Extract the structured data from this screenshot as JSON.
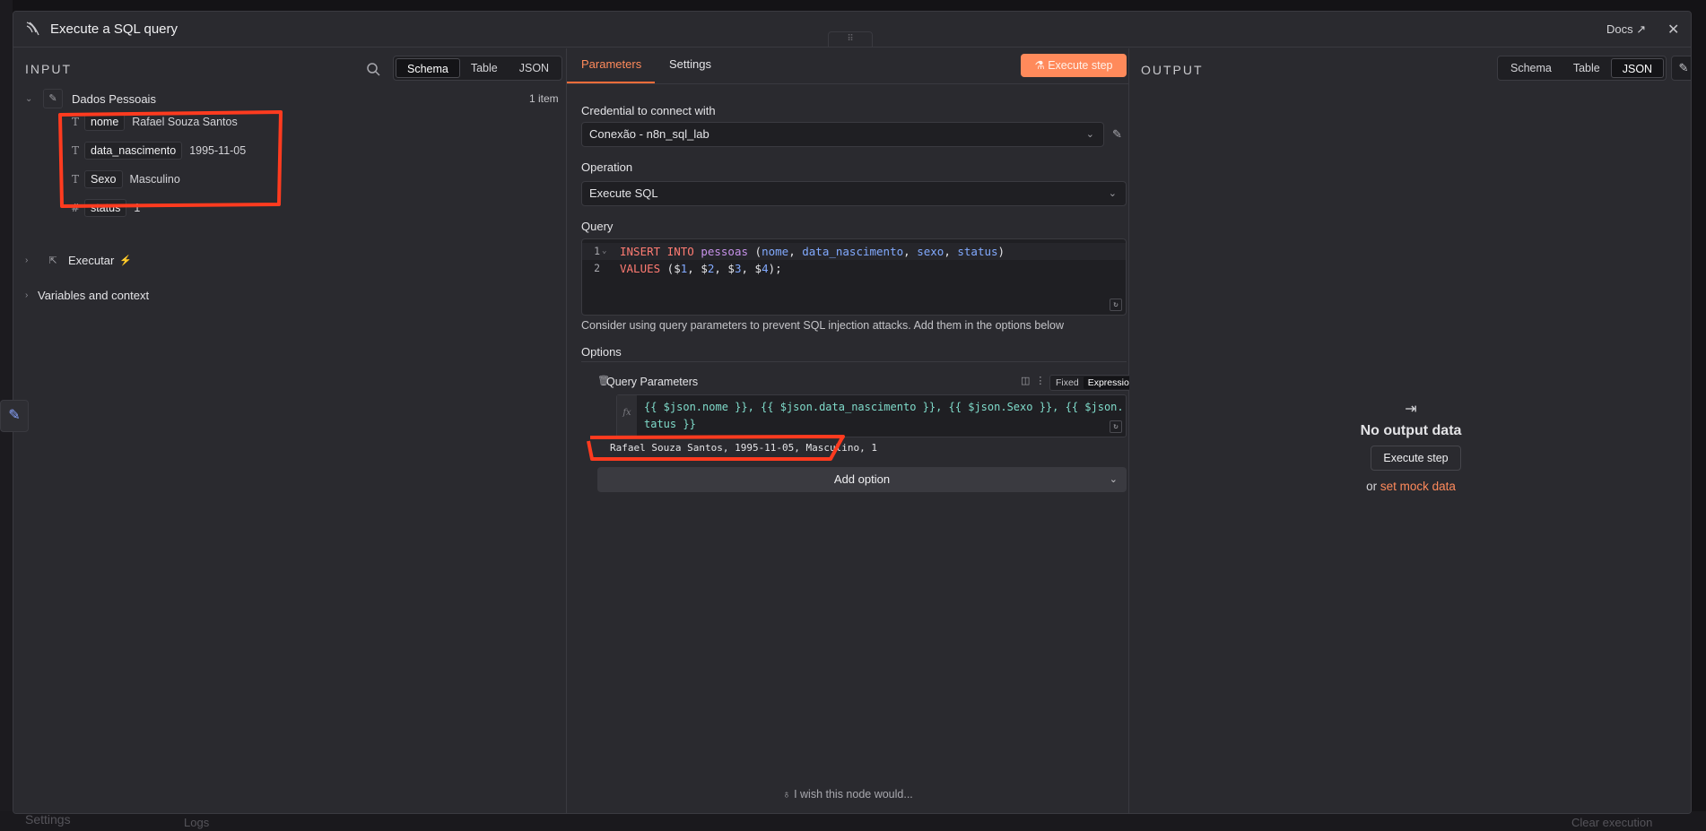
{
  "window": {
    "title": "Execute a SQL query",
    "docs_label": "Docs",
    "drag_handle": "⠿"
  },
  "background": {
    "settings_label": "Settings",
    "logs_label": "Logs",
    "clear_label": "Clear execution"
  },
  "input": {
    "label": "INPUT",
    "view_tabs": [
      "Schema",
      "Table",
      "JSON"
    ],
    "active_view": "Schema",
    "node_name": "Dados Pessoais",
    "item_count": "1 item",
    "fields": [
      {
        "type": "T",
        "key": "nome",
        "value": "Rafael Souza Santos"
      },
      {
        "type": "T",
        "key": "data_nascimento",
        "value": "1995-11-05"
      },
      {
        "type": "T",
        "key": "Sexo",
        "value": "Masculino"
      },
      {
        "type": "#",
        "key": "status",
        "value": "1"
      }
    ],
    "executar_label": "Executar",
    "variables_label": "Variables and context"
  },
  "params": {
    "tabs": [
      "Parameters",
      "Settings"
    ],
    "active_tab": "Parameters",
    "execute_label": "Execute step",
    "credential_label": "Credential to connect with",
    "credential_value": "Conexão - n8n_sql_lab",
    "operation_label": "Operation",
    "operation_value": "Execute SQL",
    "query_label": "Query",
    "query_lines": [
      {
        "n": "1",
        "text": "INSERT INTO pessoas (nome, data_nascimento, sexo, status)"
      },
      {
        "n": "2",
        "text": "VALUES ($1, $2, $3, $4);"
      }
    ],
    "hint": "Consider using query parameters to prevent SQL injection attacks. Add them in the options below",
    "options_label": "Options",
    "query_params_label": "Query Parameters",
    "mode_fixed": "Fixed",
    "mode_expression": "Expression",
    "expression_line1": "{{ $json.nome }}, {{ $json.data_nascimento }}, {{ $json.Sexo }}, {{ $json.s",
    "expression_line2": "tatus }}",
    "expression_result": "Rafael Souza Santos, 1995-11-05, Masculino, 1",
    "add_option_label": "Add option",
    "wish_label": "I wish this node would..."
  },
  "output": {
    "label": "OUTPUT",
    "view_tabs": [
      "Schema",
      "Table",
      "JSON"
    ],
    "active_view": "JSON",
    "no_output_title": "No output data",
    "execute_label": "Execute step",
    "or_label": "or",
    "mock_label": "set mock data"
  },
  "colors": {
    "accent": "#ff6d3a",
    "annotation": "#ff3b1f"
  }
}
